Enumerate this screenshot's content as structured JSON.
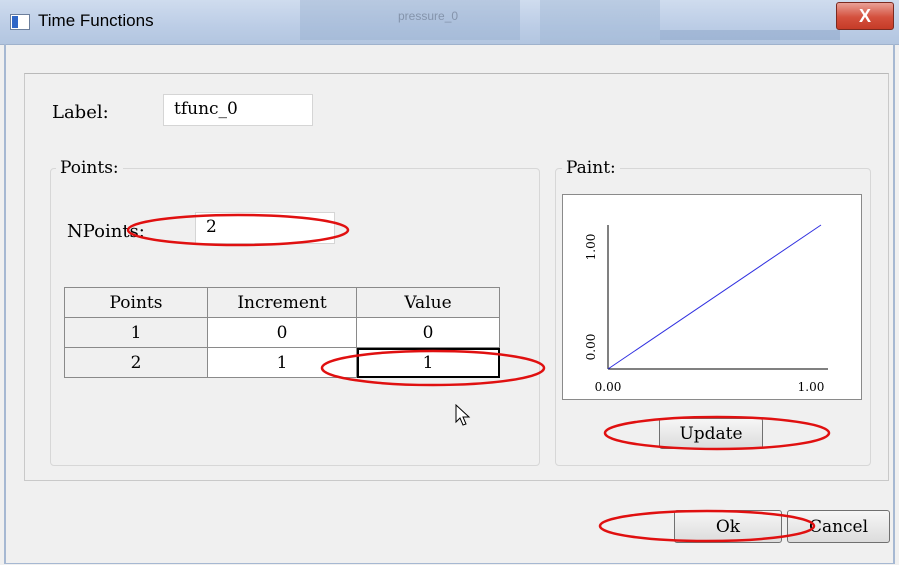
{
  "window": {
    "title": "Time Functions",
    "background_tab_text": "pressure_0",
    "close_label": "X"
  },
  "label_field": {
    "caption": "Label:",
    "value": "tfunc_0"
  },
  "points_group": {
    "title": "Points:",
    "npoints_caption": "NPoints:",
    "npoints_value": "2",
    "table": {
      "headers": [
        "Points",
        "Increment",
        "Value"
      ],
      "rows": [
        [
          "1",
          "0",
          "0"
        ],
        [
          "2",
          "1",
          "1"
        ]
      ]
    }
  },
  "paint_group": {
    "title": "Paint:",
    "plot": {
      "x_ticks": [
        "0.00",
        "1.00"
      ],
      "y_ticks": [
        "0.00",
        "1.00"
      ],
      "line_color": "#3030e0"
    },
    "update_label": "Update"
  },
  "footer": {
    "ok_label": "Ok",
    "cancel_label": "Cancel"
  },
  "chart_data": {
    "type": "line",
    "x": [
      0,
      1
    ],
    "series": [
      {
        "values": [
          0,
          1
        ]
      }
    ],
    "xlim": [
      0,
      1
    ],
    "ylim": [
      0,
      1
    ]
  },
  "annotations": {
    "circle_color": "#e01010"
  }
}
